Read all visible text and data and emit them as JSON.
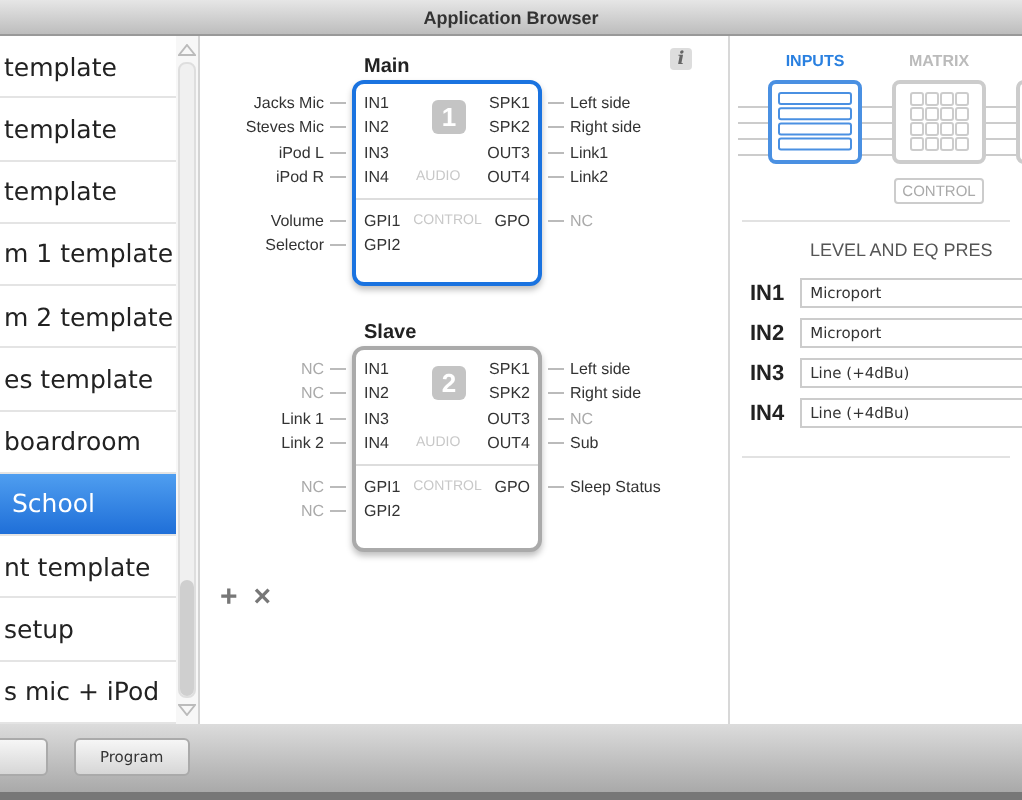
{
  "window": {
    "title": "Application Browser"
  },
  "templates": [
    {
      "label": "template",
      "selected": false
    },
    {
      "label": "template",
      "selected": false
    },
    {
      "label": "template",
      "selected": false
    },
    {
      "label": "m 1 template",
      "selected": false
    },
    {
      "label": "m 2 template",
      "selected": false
    },
    {
      "label": "es template",
      "selected": false
    },
    {
      "label": "boardroom",
      "selected": false
    },
    {
      "label": "School",
      "selected": true
    },
    {
      "label": "nt template",
      "selected": false
    },
    {
      "label": "setup",
      "selected": false
    },
    {
      "label": "s mic + iPod",
      "selected": false
    }
  ],
  "devices": [
    {
      "title": "Main",
      "number": "1",
      "selected": true,
      "audio_label": "AUDIO",
      "control_label": "CONTROL",
      "inputs": [
        {
          "source": "Jacks Mic",
          "port": "IN1",
          "connected": true
        },
        {
          "source": "Steves Mic",
          "port": "IN2",
          "connected": true
        },
        {
          "source": "iPod L",
          "port": "IN3",
          "connected": true
        },
        {
          "source": "iPod R",
          "port": "IN4",
          "connected": true
        }
      ],
      "outputs": [
        {
          "port": "SPK1",
          "dest": "Left side",
          "connected": true
        },
        {
          "port": "SPK2",
          "dest": "Right side",
          "connected": true
        },
        {
          "port": "OUT3",
          "dest": "Link1",
          "connected": true
        },
        {
          "port": "OUT4",
          "dest": "Link2",
          "connected": true
        }
      ],
      "gpi": [
        {
          "source": "Volume",
          "port": "GPI1",
          "connected": true
        },
        {
          "source": "Selector",
          "port": "GPI2",
          "connected": true
        }
      ],
      "gpo": {
        "port": "GPO",
        "dest": "NC",
        "connected": false
      }
    },
    {
      "title": "Slave",
      "number": "2",
      "selected": false,
      "audio_label": "AUDIO",
      "control_label": "CONTROL",
      "inputs": [
        {
          "source": "NC",
          "port": "IN1",
          "connected": false
        },
        {
          "source": "NC",
          "port": "IN2",
          "connected": false
        },
        {
          "source": "Link 1",
          "port": "IN3",
          "connected": true
        },
        {
          "source": "Link 2",
          "port": "IN4",
          "connected": true
        }
      ],
      "outputs": [
        {
          "port": "SPK1",
          "dest": "Left side",
          "connected": true
        },
        {
          "port": "SPK2",
          "dest": "Right side",
          "connected": true
        },
        {
          "port": "OUT3",
          "dest": "NC",
          "connected": false
        },
        {
          "port": "OUT4",
          "dest": "Sub",
          "connected": true
        }
      ],
      "gpi": [
        {
          "source": "NC",
          "port": "GPI1",
          "connected": false
        },
        {
          "source": "NC",
          "port": "GPI2",
          "connected": false
        }
      ],
      "gpo": {
        "port": "GPO",
        "dest": "Sleep Status",
        "connected": true
      }
    }
  ],
  "device_actions": [
    "+",
    "×"
  ],
  "info_button": "i",
  "stages": [
    {
      "kind": "inputs",
      "label": "INPUTS",
      "selected": true
    },
    {
      "kind": "matrix",
      "label": "MATRIX",
      "selected": false,
      "sub_button": "CONTROL"
    },
    {
      "kind": "outputs",
      "selected": false
    }
  ],
  "presets": {
    "heading": "LEVEL AND EQ PRES",
    "rows": [
      {
        "channel": "IN1",
        "value": "Microport"
      },
      {
        "channel": "IN2",
        "value": "Microport"
      },
      {
        "channel": "IN3",
        "value": "Line (+4dBu)"
      },
      {
        "channel": "IN4",
        "value": "Line (+4dBu)"
      }
    ]
  },
  "bottom_buttons": [
    {
      "kind": "blank"
    },
    {
      "kind": "text",
      "label": "Program"
    }
  ]
}
